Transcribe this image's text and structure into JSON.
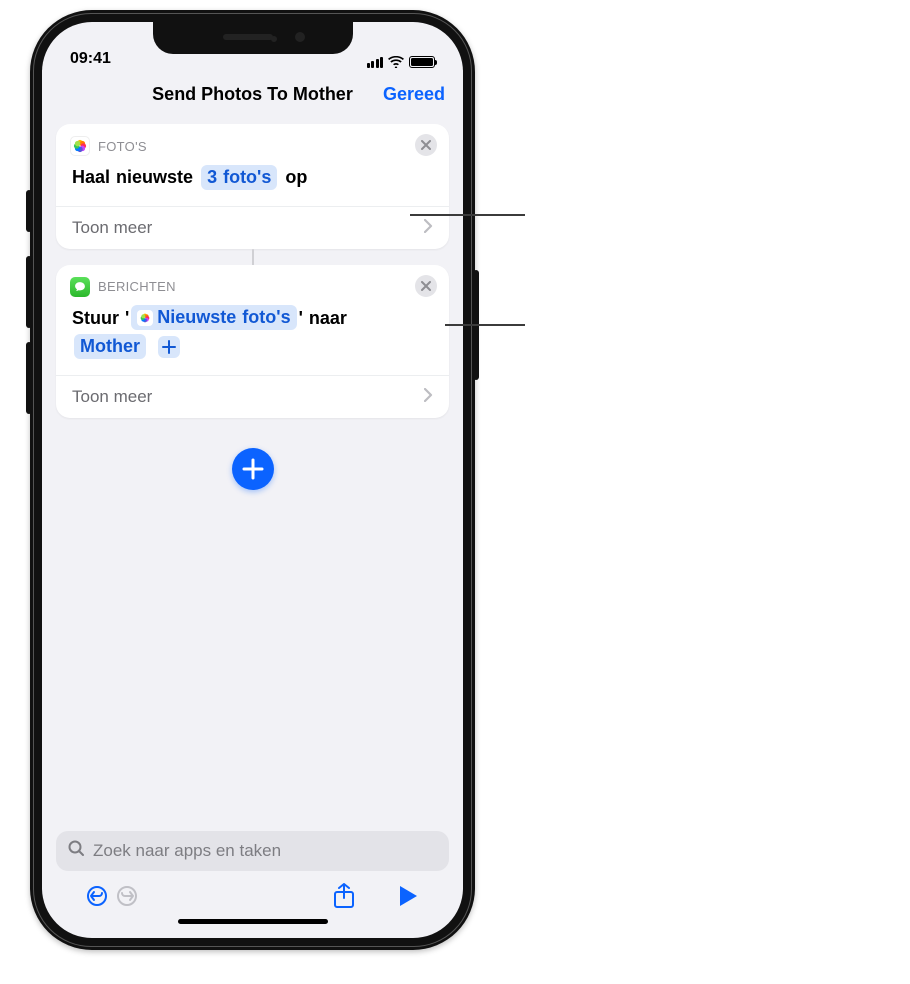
{
  "status": {
    "time": "09:41"
  },
  "nav": {
    "title": "Send Photos To Mother",
    "done": "Gereed"
  },
  "card1": {
    "app": "FOTO'S",
    "text_prefix": "Haal nieuwste",
    "pill": "3 foto's",
    "text_suffix": "op",
    "footer": "Toon meer"
  },
  "card2": {
    "app": "BERICHTEN",
    "text_prefix": "Stuur '",
    "pill1": "Nieuwste foto's",
    "text_mid": "' naar",
    "pill2": "Mother",
    "footer": "Toon meer"
  },
  "search": {
    "placeholder": "Zoek naar apps en taken"
  }
}
